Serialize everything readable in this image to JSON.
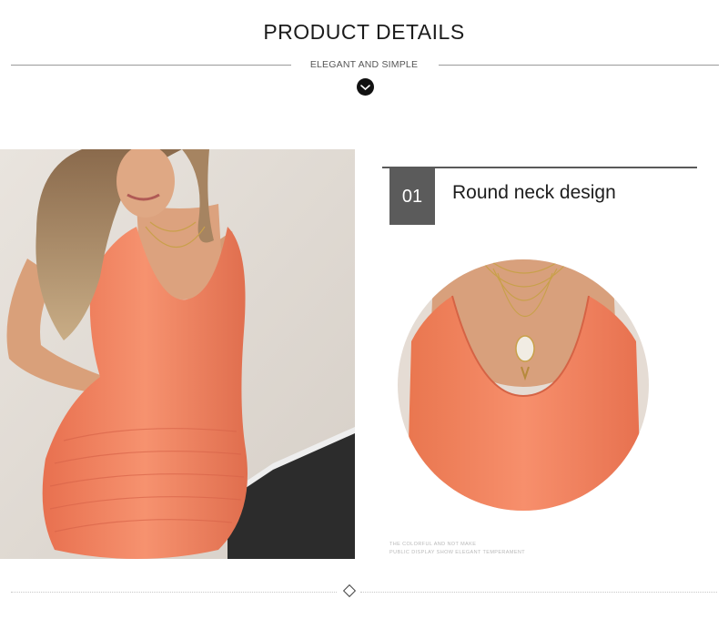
{
  "header": {
    "title": "PRODUCT DETAILS",
    "subtitle": "ELEGANT AND SIMPLE",
    "scroll_icon": "chevron-down-icon"
  },
  "main_image": {
    "icon": "dress-photo"
  },
  "feature": {
    "number": "01",
    "title": "Round neck design",
    "caption_line1": "THE COLORFUL AND NOT MAKE",
    "caption_line2": "PUBLIC DISPLAY SHOW ELEGANT TEMPERAMENT"
  },
  "footer": {
    "divider_icon": "diamond-icon"
  },
  "colors": {
    "dress": "#f08a6a",
    "box": "#5b5b5b",
    "background": "#ffffff"
  }
}
